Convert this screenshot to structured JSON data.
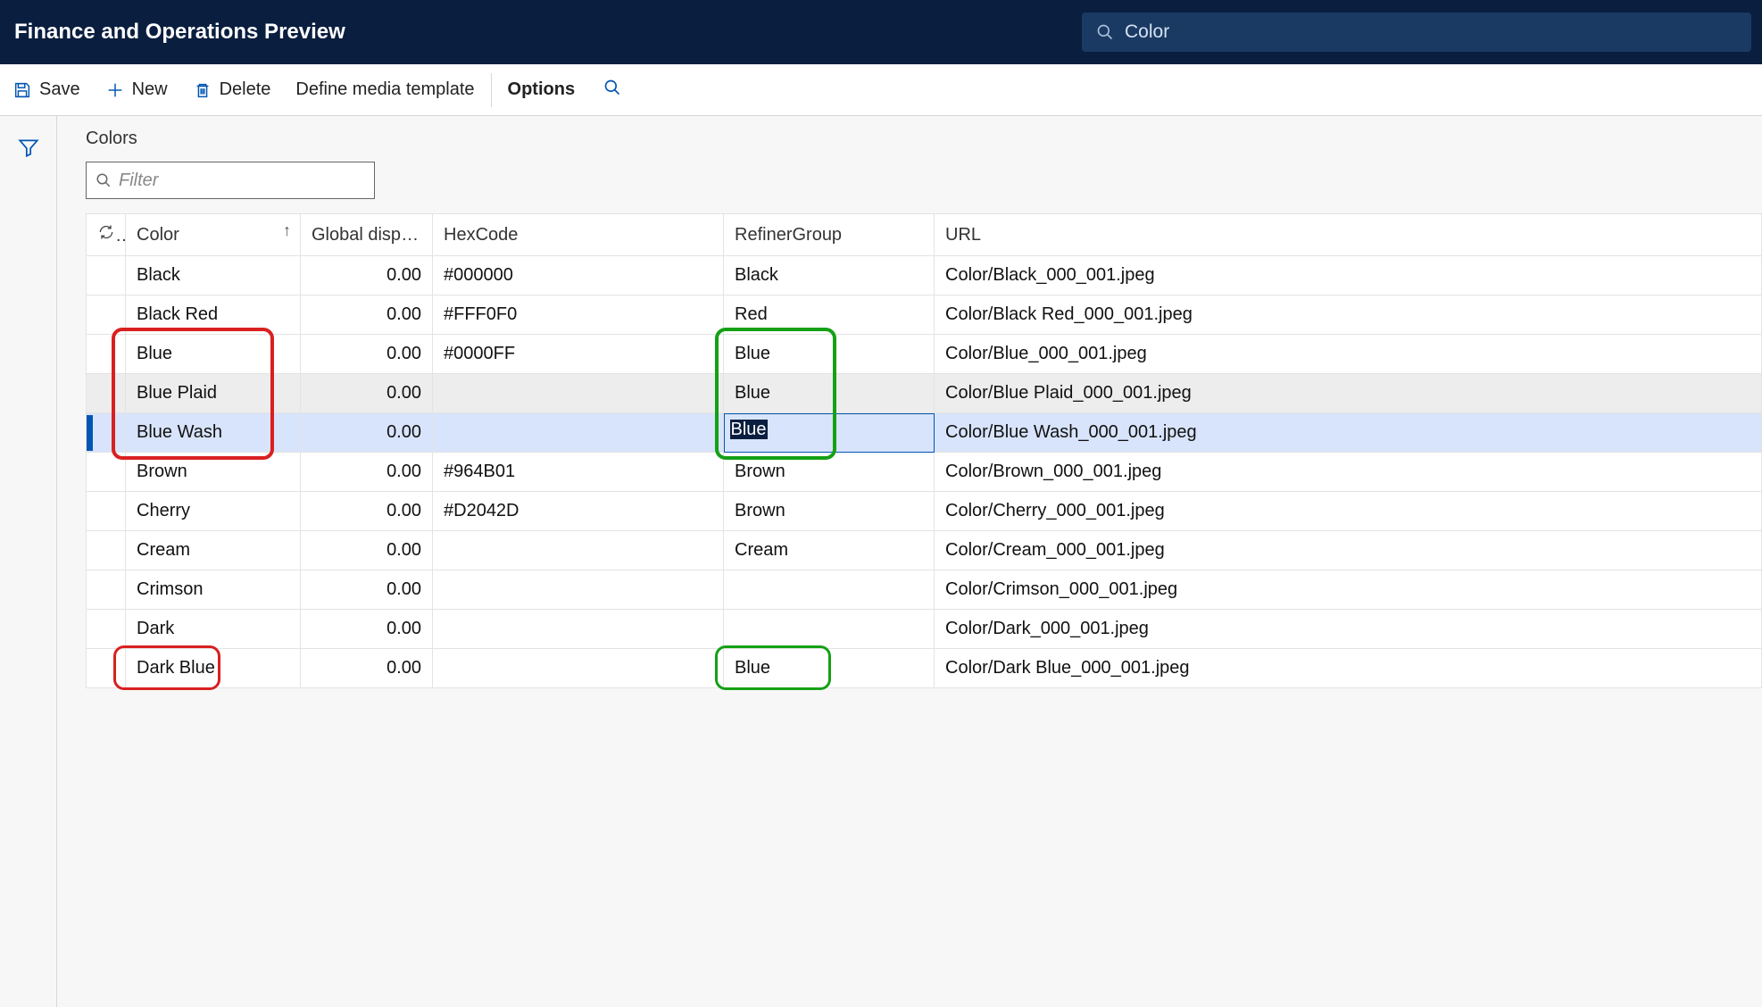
{
  "app_title": "Finance and Operations Preview",
  "search": {
    "value": "Color"
  },
  "toolbar": {
    "save": "Save",
    "new": "New",
    "delete": "Delete",
    "define_media": "Define media template",
    "options": "Options"
  },
  "page_title": "Colors",
  "filter_placeholder": "Filter",
  "columns": {
    "color": "Color",
    "gdo": "Global display ...",
    "hex": "HexCode",
    "refiner": "RefinerGroup",
    "url": "URL"
  },
  "rows": [
    {
      "color": "Black",
      "gdo": "0.00",
      "hex": "#000000",
      "refiner": "Black",
      "url": "Color/Black_000_001.jpeg",
      "state": "normal"
    },
    {
      "color": "Black Red",
      "gdo": "0.00",
      "hex": "#FFF0F0",
      "refiner": "Red",
      "url": "Color/Black Red_000_001.jpeg",
      "state": "normal"
    },
    {
      "color": "Blue",
      "gdo": "0.00",
      "hex": "#0000FF",
      "refiner": "Blue",
      "url": "Color/Blue_000_001.jpeg",
      "state": "normal"
    },
    {
      "color": "Blue Plaid",
      "gdo": "0.00",
      "hex": "",
      "refiner": "Blue",
      "url": "Color/Blue Plaid_000_001.jpeg",
      "state": "zebra"
    },
    {
      "color": "Blue Wash",
      "gdo": "0.00",
      "hex": "",
      "refiner": "Blue",
      "url": "Color/Blue Wash_000_001.jpeg",
      "state": "selected"
    },
    {
      "color": "Brown",
      "gdo": "0.00",
      "hex": "#964B01",
      "refiner": "Brown",
      "url": "Color/Brown_000_001.jpeg",
      "state": "normal"
    },
    {
      "color": "Cherry",
      "gdo": "0.00",
      "hex": "#D2042D",
      "refiner": "Brown",
      "url": "Color/Cherry_000_001.jpeg",
      "state": "normal"
    },
    {
      "color": "Cream",
      "gdo": "0.00",
      "hex": "",
      "refiner": "Cream",
      "url": "Color/Cream_000_001.jpeg",
      "state": "normal"
    },
    {
      "color": "Crimson",
      "gdo": "0.00",
      "hex": "",
      "refiner": "",
      "url": "Color/Crimson_000_001.jpeg",
      "state": "normal"
    },
    {
      "color": "Dark",
      "gdo": "0.00",
      "hex": "",
      "refiner": "",
      "url": "Color/Dark_000_001.jpeg",
      "state": "normal"
    },
    {
      "color": "Dark Blue",
      "gdo": "0.00",
      "hex": "",
      "refiner": "Blue",
      "url": "Color/Dark Blue_000_001.jpeg",
      "state": "normal"
    }
  ],
  "edit_cell_value": "Blue"
}
